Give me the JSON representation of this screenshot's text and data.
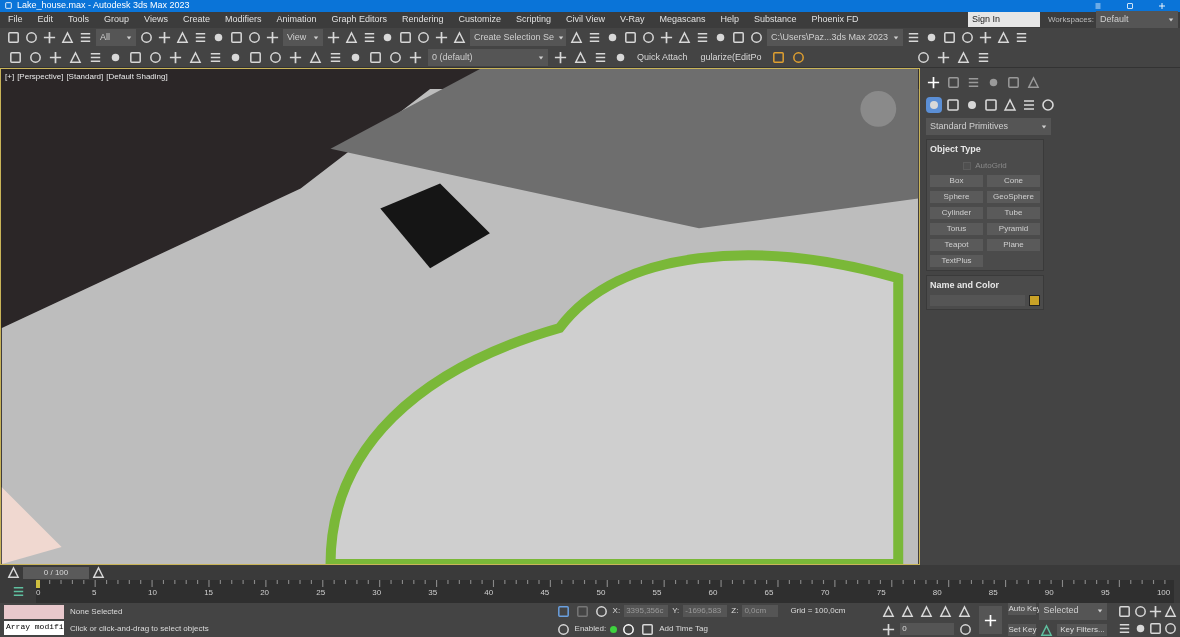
{
  "window": {
    "title": "Lake_house.max - Autodesk 3ds Max 2023"
  },
  "menu": [
    "File",
    "Edit",
    "Tools",
    "Group",
    "Views",
    "Create",
    "Modifiers",
    "Animation",
    "Graph Editors",
    "Rendering",
    "Customize",
    "Scripting",
    "Civil View",
    "V-Ray",
    "Megascans",
    "Help",
    "Substance",
    "Phoenix FD"
  ],
  "account": {
    "sign_in": "Sign In",
    "workspaces_label": "Workspaces:",
    "workspace": "Default"
  },
  "main_toolbar": {
    "selection_filter": "All",
    "reference_coord": "View",
    "named_selection": "Create Selection Se",
    "project_path": "C:\\Users\\Paz...3ds Max 2023"
  },
  "secondary_toolbar": {
    "layer": "0 (default)",
    "quick_attach": "Quick Attach",
    "tool_3": "gularize(EditPo"
  },
  "viewport": {
    "labels": [
      "[+]",
      "[Perspective]",
      "[Standard]",
      "[Default Shading]"
    ]
  },
  "command_panel": {
    "tabs": [
      {
        "selected": true
      },
      {
        "selected": false
      },
      {
        "selected": false
      },
      {
        "selected": false
      },
      {
        "selected": false
      },
      {
        "selected": false
      }
    ],
    "categories": [
      {
        "selected": true
      },
      {
        "selected": false
      },
      {
        "selected": false
      },
      {
        "selected": false
      },
      {
        "selected": false
      },
      {
        "selected": false
      },
      {
        "selected": false
      }
    ],
    "category_dropdown": "Standard Primitives",
    "object_type": {
      "title": "Object Type",
      "autogrid": {
        "label": "AutoGrid",
        "checked": false
      },
      "buttons": [
        "Box",
        "Cone",
        "Sphere",
        "GeoSphere",
        "Cylinder",
        "Tube",
        "Torus",
        "Pyramid",
        "Teapot",
        "Plane",
        "TextPlus"
      ]
    },
    "name_and_color": {
      "title": "Name and Color",
      "color": "#c9a227"
    }
  },
  "timeline": {
    "frame_counter": "0 / 100",
    "ruler_labels": [
      "0",
      "5",
      "10",
      "15",
      "20",
      "25",
      "30",
      "35",
      "40",
      "45",
      "50",
      "55",
      "60",
      "65",
      "70",
      "75",
      "80",
      "85",
      "90",
      "95",
      "100"
    ]
  },
  "status_bar": {
    "listener": "Array modifi",
    "selection": "None Selected",
    "prompt": "Click or click-and-drag to select objects",
    "x_label": "X:",
    "x_value": "3395,356c",
    "y_label": "Y:",
    "y_value": "-1696,583",
    "z_label": "Z:",
    "z_value": "0,0cm",
    "grid": "Grid = 100,0cm",
    "enabled_label": "Enabled:",
    "add_time_tag": "Add Time Tag",
    "current_frame": "0",
    "auto_key": "Auto Key",
    "key_mode": "Selected",
    "set_key": "Set Key",
    "key_filters": "Key Filters..."
  }
}
